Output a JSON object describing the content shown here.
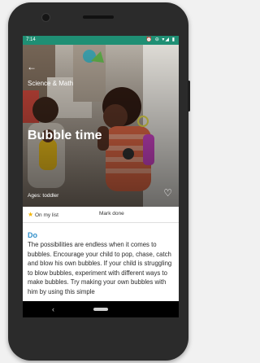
{
  "status_bar": {
    "time": "7:14",
    "icons": "⏰ ⊖ ▾◢ ▮"
  },
  "nav": {
    "back_icon": "arrow-left",
    "android_back": "‹"
  },
  "hero": {
    "category": "Science & Math",
    "title": "Bubble time",
    "ages": "Ages: toddler",
    "favorite_icon": "heart-outline"
  },
  "actions": {
    "on_list": "On my list",
    "mark_done": "Mark done",
    "star_color": "#f4b400"
  },
  "content": {
    "section_title": "Do",
    "body": "The possibilities are endless when it comes to bubbles. Encourage your child to pop, chase, catch and blow his own bubbles. If your child is struggling to blow bubbles, experiment with different ways to make bubbles. Try making your own bubbles with him by using this simple"
  },
  "colors": {
    "status_bar": "#1f8f74",
    "accent": "#2f8ec9"
  }
}
